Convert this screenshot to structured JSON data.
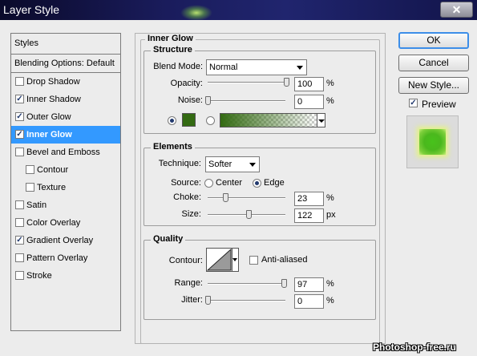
{
  "window": {
    "title": "Layer Style",
    "close_glyph": "✕"
  },
  "styles_panel": {
    "header": "Styles",
    "blending_options": "Blending Options: Default",
    "items": [
      {
        "label": "Drop Shadow",
        "checked": false,
        "selected": false,
        "sub": false
      },
      {
        "label": "Inner Shadow",
        "checked": true,
        "selected": false,
        "sub": false
      },
      {
        "label": "Outer Glow",
        "checked": true,
        "selected": false,
        "sub": false
      },
      {
        "label": "Inner Glow",
        "checked": true,
        "selected": true,
        "sub": false
      },
      {
        "label": "Bevel and Emboss",
        "checked": false,
        "selected": false,
        "sub": false
      },
      {
        "label": "Contour",
        "checked": false,
        "selected": false,
        "sub": true
      },
      {
        "label": "Texture",
        "checked": false,
        "selected": false,
        "sub": true
      },
      {
        "label": "Satin",
        "checked": false,
        "selected": false,
        "sub": false
      },
      {
        "label": "Color Overlay",
        "checked": false,
        "selected": false,
        "sub": false
      },
      {
        "label": "Gradient Overlay",
        "checked": true,
        "selected": false,
        "sub": false
      },
      {
        "label": "Pattern Overlay",
        "checked": false,
        "selected": false,
        "sub": false
      },
      {
        "label": "Stroke",
        "checked": false,
        "selected": false,
        "sub": false
      }
    ]
  },
  "inner_glow": {
    "title": "Inner Glow",
    "structure": {
      "title": "Structure",
      "blend_mode_label": "Blend Mode:",
      "blend_mode_value": "Normal",
      "opacity_label": "Opacity:",
      "opacity_value": "100",
      "noise_label": "Noise:",
      "noise_value": "0",
      "percent": "%",
      "glow_color": "#336a12"
    },
    "elements": {
      "title": "Elements",
      "technique_label": "Technique:",
      "technique_value": "Softer",
      "source_label": "Source:",
      "source_center": "Center",
      "source_edge": "Edge",
      "choke_label": "Choke:",
      "choke_value": "23",
      "size_label": "Size:",
      "size_value": "122",
      "percent": "%",
      "px": "px"
    },
    "quality": {
      "title": "Quality",
      "contour_label": "Contour:",
      "anti_aliased_label": "Anti-aliased",
      "range_label": "Range:",
      "range_value": "97",
      "jitter_label": "Jitter:",
      "jitter_value": "0",
      "percent": "%"
    }
  },
  "buttons": {
    "ok": "OK",
    "cancel": "Cancel",
    "new_style": "New Style...",
    "preview_label": "Preview"
  },
  "watermark": "Photoshop-free.ru"
}
